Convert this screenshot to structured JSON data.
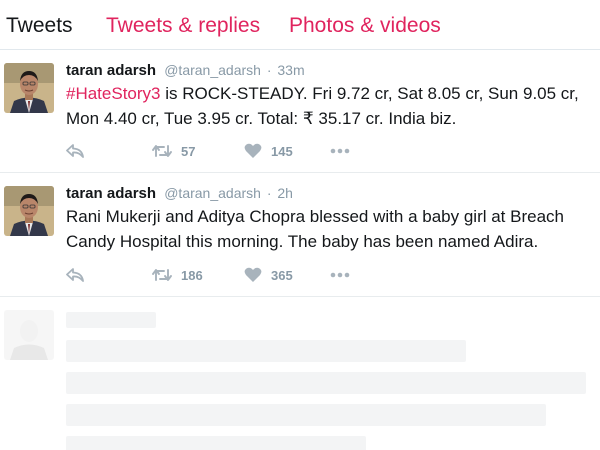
{
  "tabs": {
    "tweets": "Tweets",
    "replies": "Tweets & replies",
    "media": "Photos & videos"
  },
  "colors": {
    "accent": "#e0245e",
    "muted": "#8899a6",
    "text": "#14171a"
  },
  "tweets": [
    {
      "name": "taran adarsh",
      "handle": "@taran_adarsh",
      "time": "33m",
      "hashtag": "#HateStory3",
      "line1_rest": " is ROCK-STEADY. Fri 9.72 cr, Sat 8.05 cr, Sun 9.05 cr,",
      "line2": "Mon 4.40 cr, Tue 3.95 cr. Total: ₹ 35.17 cr. India biz.",
      "retweets": "57",
      "likes": "145"
    },
    {
      "name": "taran adarsh",
      "handle": "@taran_adarsh",
      "time": "2h",
      "line1": "Rani Mukerji and Aditya Chopra blessed with a baby girl at Breach",
      "line2": "Candy Hospital this morning. The baby has been named Adira.",
      "retweets": "186",
      "likes": "365"
    }
  ],
  "icons": {
    "reply": "reply-icon",
    "retweet": "retweet-icon",
    "like": "heart-icon",
    "more": "more-icon"
  }
}
